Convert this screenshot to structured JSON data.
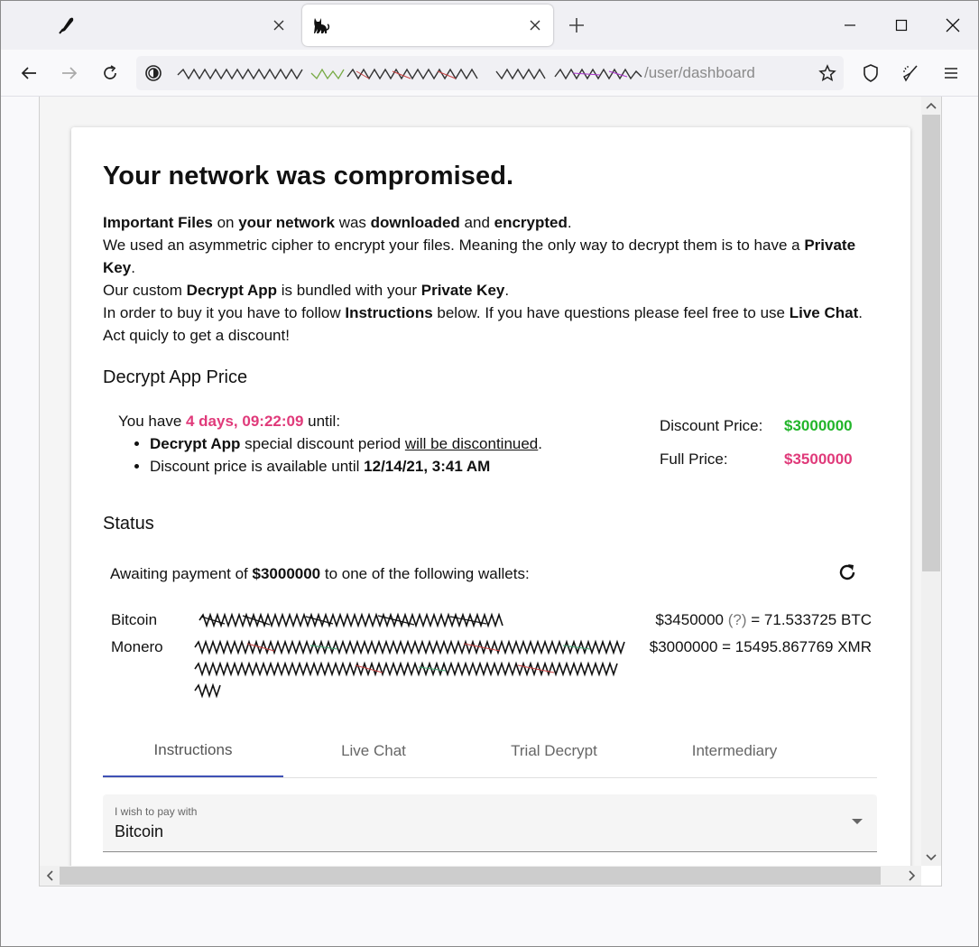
{
  "browser": {
    "tab_inactive_icon": "feather-pen-icon",
    "tab_active_icon": "black-cat-icon",
    "url_visible_path": "/user/dashboard"
  },
  "page": {
    "title": "Your network was compromised.",
    "intro": {
      "l1": {
        "a": "Important Files",
        "b": " on ",
        "c": "your network",
        "d": " was ",
        "e": "downloaded",
        "f": " and ",
        "g": "encrypted",
        "h": "."
      },
      "l2": {
        "a": "We used an asymmetric cipher to encrypt your files. Meaning the only way to decrypt them is to have a ",
        "b": "Private Key",
        "c": "."
      },
      "l3": {
        "a": "Our custom ",
        "b": "Decrypt App",
        "c": " is bundled with your ",
        "d": "Private Key",
        "e": "."
      },
      "l4": {
        "a": "In order to buy it you have to follow ",
        "b": "Instructions",
        "c": " below. If you have questions please feel free to use ",
        "d": "Live Chat",
        "e": "."
      },
      "l5": "Act quicly to get a discount!"
    },
    "price_heading": "Decrypt App Price",
    "timer": {
      "prefix": "You have ",
      "value": "4 days, 09:22:09",
      "suffix": " until:",
      "b1": {
        "a": "Decrypt App",
        "b": " special discount period ",
        "c": "will be discontinued",
        "d": "."
      },
      "b2": {
        "a": "Discount price is available until ",
        "b": "12/14/21, 3:41 AM"
      }
    },
    "prices": {
      "discount_label": "Discount Price:",
      "discount_value": "$3000000",
      "full_label": "Full Price:",
      "full_value": "$3500000"
    },
    "status_heading": "Status",
    "awaiting": {
      "a": "Awaiting payment of ",
      "b": "$3000000",
      "c": " to one of the following wallets:"
    },
    "wallets": [
      {
        "name": "Bitcoin",
        "conv_a": "$3450000 ",
        "conv_q": "(?)",
        "conv_b": " = 71.533725 BTC"
      },
      {
        "name": "Monero",
        "conv_a": "$3000000 = 15495.867769 XMR"
      }
    ],
    "tabs": [
      "Instructions",
      "Live Chat",
      "Trial Decrypt",
      "Intermediary"
    ],
    "select": {
      "label": "I wish to pay with",
      "value": "Bitcoin"
    }
  },
  "colors": {
    "accent": "#3f51b5",
    "pink": "#e03a7a",
    "green": "#22b52a"
  }
}
